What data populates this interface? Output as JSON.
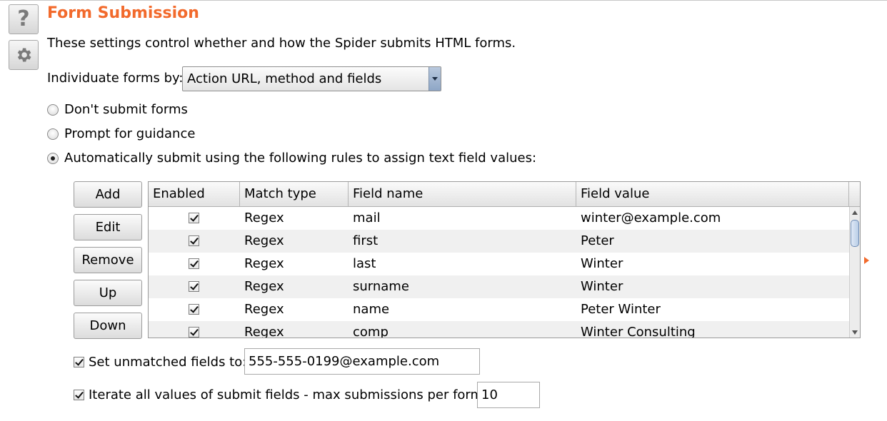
{
  "section": {
    "title": "Form Submission",
    "description": "These settings control whether and how the Spider submits HTML forms."
  },
  "side_buttons": {
    "help_icon": "question-mark-icon",
    "help_glyph": "?",
    "settings_icon": "gear-icon"
  },
  "individuate": {
    "label": "Individuate forms by:",
    "selected": "Action URL, method and fields"
  },
  "radios": [
    {
      "label": "Don't submit forms",
      "checked": false
    },
    {
      "label": "Prompt for guidance",
      "checked": false
    },
    {
      "label": "Automatically submit using the following rules to assign text field values:",
      "checked": true
    }
  ],
  "buttons": {
    "add": "Add",
    "edit": "Edit",
    "remove": "Remove",
    "up": "Up",
    "down": "Down"
  },
  "table": {
    "columns": [
      "Enabled",
      "Match type",
      "Field name",
      "Field value"
    ],
    "rows": [
      {
        "enabled": true,
        "match_type": "Regex",
        "field_name": "mail",
        "field_value": "winter@example.com"
      },
      {
        "enabled": true,
        "match_type": "Regex",
        "field_name": "first",
        "field_value": "Peter"
      },
      {
        "enabled": true,
        "match_type": "Regex",
        "field_name": "last",
        "field_value": "Winter"
      },
      {
        "enabled": true,
        "match_type": "Regex",
        "field_name": "surname",
        "field_value": "Winter"
      },
      {
        "enabled": true,
        "match_type": "Regex",
        "field_name": "name",
        "field_value": "Peter Winter"
      },
      {
        "enabled": true,
        "match_type": "Regex",
        "field_name": "comp",
        "field_value": "Winter Consulting"
      }
    ]
  },
  "unmatched": {
    "checked": true,
    "label": "Set unmatched fields to:",
    "value": "555-555-0199@example.com"
  },
  "iterate": {
    "checked": true,
    "label": "Iterate all values of submit fields - max submissions per form:",
    "value": "10"
  },
  "colors": {
    "title_accent": "#f26a2c",
    "alt_row": "#f0f0f0"
  }
}
